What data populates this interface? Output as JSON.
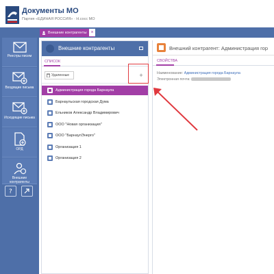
{
  "header": {
    "title": "Документы МО",
    "subtitle": "Партия «ЕДИНАЯ РОССИЯ» · Н.сосс МО"
  },
  "tabs": [
    {
      "label": "Внешние контрагенты"
    }
  ],
  "sidebar": {
    "items": [
      {
        "label": "Реестры писем",
        "icon": "envelope-icon"
      },
      {
        "label": "Входящие письма",
        "icon": "envelope-in-icon"
      },
      {
        "label": "Исходящие письма",
        "icon": "envelope-out-icon"
      },
      {
        "label": "ОРД",
        "icon": "document-icon"
      },
      {
        "label": "Внешние контрагенты",
        "icon": "contacts-icon"
      }
    ]
  },
  "list_panel": {
    "title": "Внешние контрагенты",
    "tab": "СПИСОК",
    "filter_label": "Удаленные",
    "add_label": "+",
    "rows": [
      "Администрация города Барнаула",
      "Барнаульская городская Дума",
      "Ельников Александр Владимирович",
      "ООО \"Новая организация\"",
      "ООО \"БарнаулЭнерго\"",
      "Организация 1",
      "Организация 2"
    ],
    "selected_index": 0
  },
  "detail_panel": {
    "title": "Внешний контрагент: Администрация гор",
    "tab": "СВОЙСТВА",
    "name_label": "Наименование:",
    "name_value": "Администрация города Барнаула",
    "email_label": "Электронная почта:"
  },
  "colors": {
    "accent": "#a23ea6",
    "brand_blue": "#4e6fa8",
    "annotation_red": "#e0393f",
    "detail_icon": "#e8823b"
  }
}
